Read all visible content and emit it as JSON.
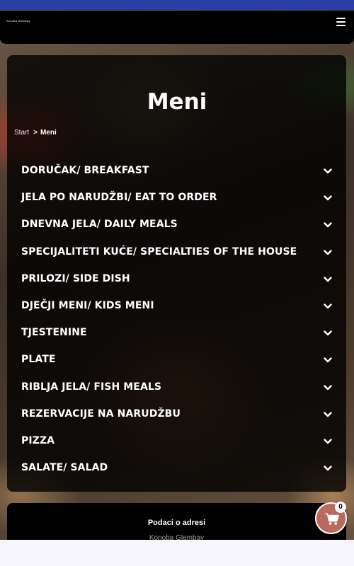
{
  "header": {
    "logo_text": "Konoba Glembay"
  },
  "page": {
    "title": "Meni"
  },
  "breadcrumb": {
    "home": "Start",
    "separator": ">",
    "current": "Meni"
  },
  "menu": {
    "items": [
      {
        "label": "DORUČAK/ BREAKFAST"
      },
      {
        "label": "JELA PO NARUDŽBI/ EAT TO ORDER"
      },
      {
        "label": "DNEVNA JELA/ DAILY MEALS"
      },
      {
        "label": "SPECIJALITETI KUĆE/ SPECIALTIES OF THE HOUSE"
      },
      {
        "label": "PRILOZI/ SIDE DISH"
      },
      {
        "label": "DJEČJI MENI/ KIDS MENI"
      },
      {
        "label": "TJESTENINE"
      },
      {
        "label": "PLATE"
      },
      {
        "label": "RIBLJA JELA/ FISH MEALS"
      },
      {
        "label": "REZERVACIJE NA NARUDŽBU"
      },
      {
        "label": "PIZZA"
      },
      {
        "label": "SALATE/ SALAD"
      }
    ]
  },
  "footer": {
    "title": "Podaci o adresi",
    "subtitle": "Konoba Glembay"
  },
  "cart": {
    "count": "0"
  },
  "colors": {
    "topbar": "#2a3ea4",
    "cart_button": "#b86a5c",
    "panel": "rgba(0,0,0,0.80)"
  }
}
